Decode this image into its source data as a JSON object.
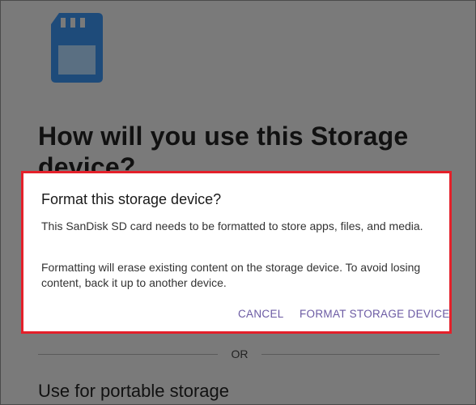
{
  "background": {
    "title": "How will you use this Storage device?",
    "title_line1": "How will you use this Storage",
    "title_line2": "device?",
    "divider_text": "OR",
    "option_label": "Use for portable storage",
    "icon": "sd-card-icon"
  },
  "dialog": {
    "title": "Format this storage device?",
    "message_1": "This SanDisk SD card needs to be formatted to store apps, files, and media.",
    "message_2": "Formatting will erase existing content on the storage device. To avoid losing content, back it up to another device.",
    "cancel_label": "CANCEL",
    "confirm_label": "FORMAT STORAGE DEVICE",
    "highlight_color": "#e4202a",
    "button_color": "#6b5aa3"
  },
  "colors": {
    "scrim": "#7a7a7a",
    "sd_card": "#1e4b7a"
  }
}
